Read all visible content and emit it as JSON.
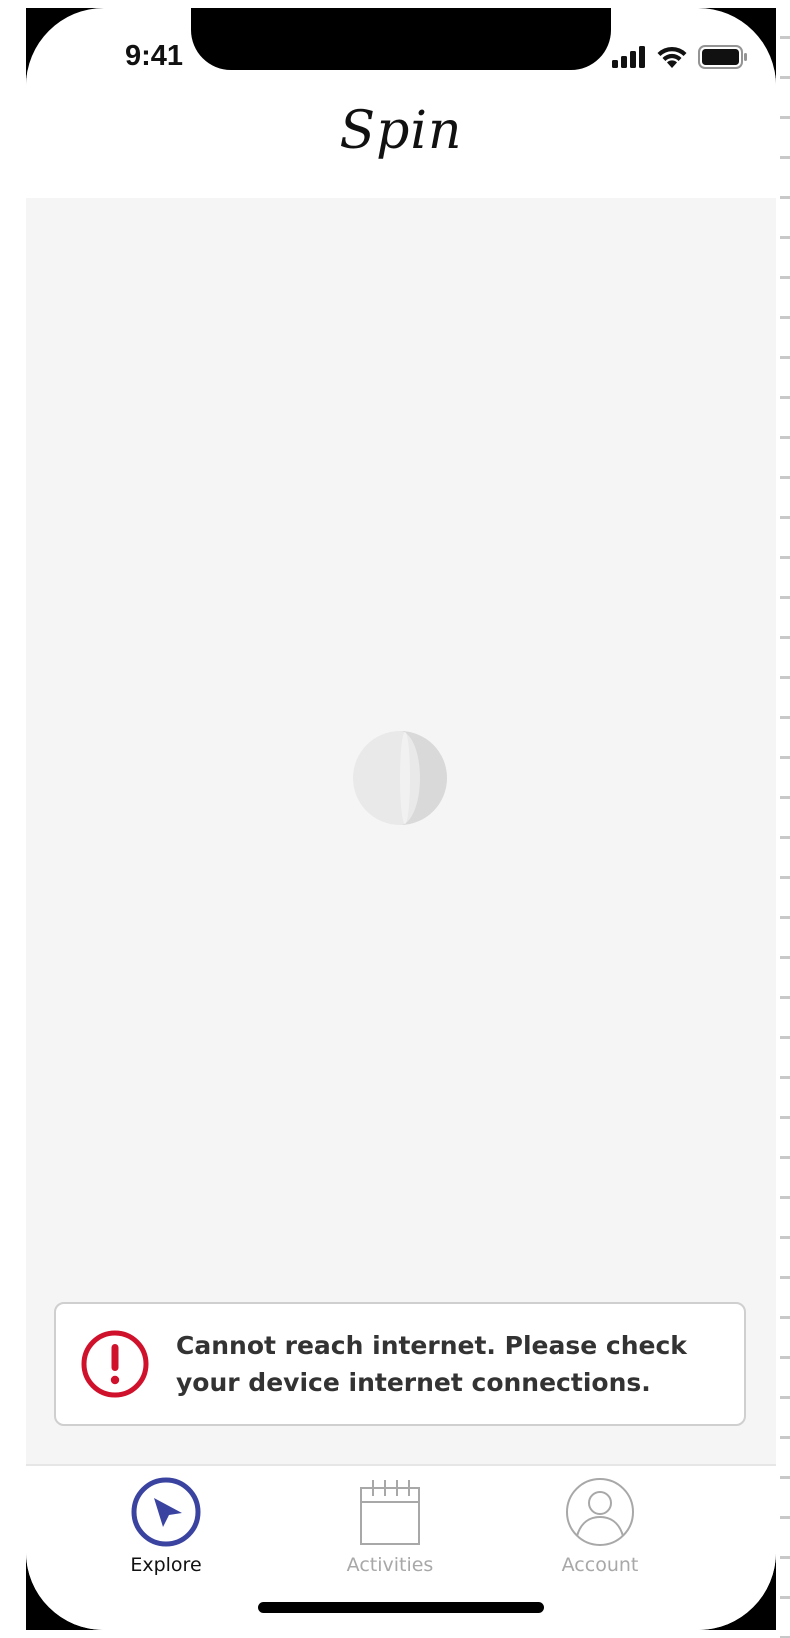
{
  "status_bar": {
    "time": "9:41"
  },
  "header": {
    "logo": "Spin"
  },
  "toast": {
    "message": "Cannot reach internet. Please check your device internet connections.",
    "icon": "error-icon",
    "accent": "#d0112b"
  },
  "tabs": [
    {
      "label": "Explore",
      "icon": "navigation-arrow-icon",
      "active": true
    },
    {
      "label": "Activities",
      "icon": "calendar-icon",
      "active": false
    },
    {
      "label": "Account",
      "icon": "user-icon",
      "active": false
    }
  ],
  "colors": {
    "active_tab": "#3a44a0",
    "inactive_tab": "#a8a8a8",
    "content_bg": "#f5f5f5"
  }
}
